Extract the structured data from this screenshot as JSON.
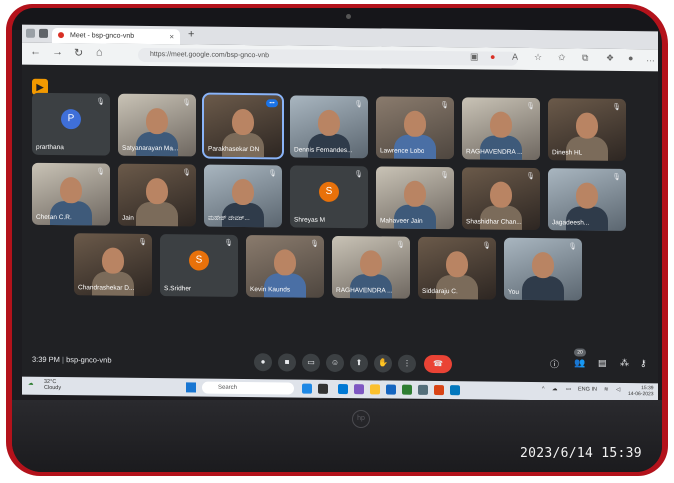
{
  "browser": {
    "tab_title": "Meet - bsp-gnco-vnb",
    "tab_close": "×",
    "new_tab": "+",
    "url": "https://meet.google.com/bsp-gnco-vnb"
  },
  "meet": {
    "meeting_time": "3:39 PM",
    "meeting_code": "bsp-gnco-vnb",
    "participant_count": "20",
    "participants_row1": [
      {
        "name": "prarthana",
        "kind": "avatar",
        "initial": "P",
        "color": "#3f6fd8"
      },
      {
        "name": "Satyanarayan Ma...",
        "kind": "video"
      },
      {
        "name": "Parakhasekar DN",
        "kind": "video",
        "active": true
      },
      {
        "name": "Dennis Fernandes...",
        "kind": "video"
      },
      {
        "name": "Lawrence Lobo",
        "kind": "video"
      },
      {
        "name": "RAGHAVENDRA ...",
        "kind": "photo"
      },
      {
        "name": "Dinesh HL",
        "kind": "video"
      }
    ],
    "participants_row2": [
      {
        "name": "Chetan C.R.",
        "kind": "photo"
      },
      {
        "name": "Jain",
        "kind": "video"
      },
      {
        "name": "ಮಹೇಶ್ ದೇವರ್...",
        "kind": "video"
      },
      {
        "name": "Shreyas M",
        "kind": "avatar",
        "initial": "S",
        "color": "#e8710a"
      },
      {
        "name": "Mahaveer Jain",
        "kind": "photo"
      },
      {
        "name": "Shashidhar Chan...",
        "kind": "video"
      },
      {
        "name": "Jagadeesh...",
        "kind": "video"
      }
    ],
    "participants_row3": [
      {
        "name": "Chandrashekar D...",
        "kind": "photo"
      },
      {
        "name": "S.Sridher",
        "kind": "avatar",
        "initial": "S",
        "color": "#e8710a"
      },
      {
        "name": "Kevin Kaunds",
        "kind": "video"
      },
      {
        "name": "RAGHAVENDRA ...",
        "kind": "video"
      },
      {
        "name": "Siddaraju C.",
        "kind": "video"
      },
      {
        "name": "You",
        "kind": "video"
      }
    ]
  },
  "taskbar": {
    "weather_temp": "32°C",
    "weather_desc": "Cloudy",
    "search_label": "Search",
    "lang": "ENG IN",
    "time": "15:39",
    "date": "14-06-2023"
  },
  "photo_timestamp": "2023/6/14 15:39",
  "laptop_logo": "hp"
}
